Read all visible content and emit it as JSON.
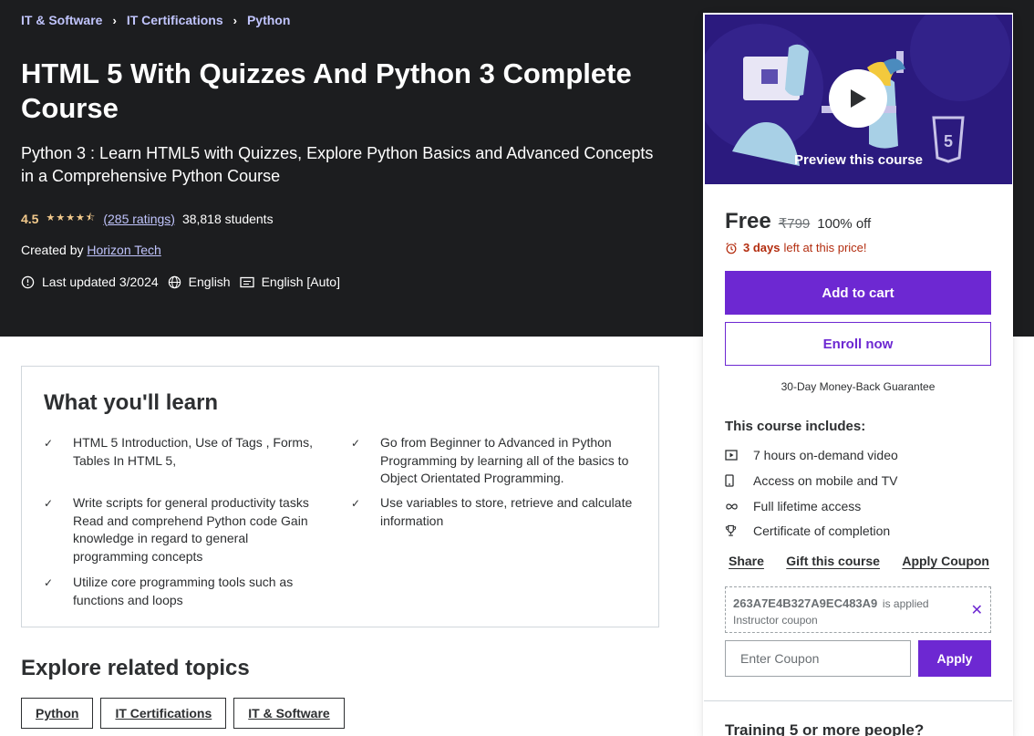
{
  "breadcrumb": [
    "IT & Software",
    "IT Certifications",
    "Python"
  ],
  "course": {
    "title": "HTML 5 With Quizzes And Python 3 Complete Course",
    "subtitle": "Python 3 : Learn HTML5 with Quizzes, Explore Python Basics and Advanced Concepts in a Comprehensive Python Course",
    "rating": "4.5",
    "stars": "★★★★⯪",
    "ratings_count": "(285 ratings)",
    "students": "38,818 students",
    "created_by_label": "Created by",
    "author": "Horizon Tech",
    "last_updated": "Last updated 3/2024",
    "language": "English",
    "captions": "English [Auto]"
  },
  "learn": {
    "title": "What you'll learn",
    "check": "✓",
    "items": [
      "HTML 5 Introduction, Use of Tags , Forms, Tables In HTML 5,",
      "Go from Beginner to Advanced in Python Programming by learning all of the basics to Object Orientated Programming.",
      "Write scripts for general productivity tasks Read and comprehend Python code Gain knowledge in regard to general programming concepts",
      "Use variables to store, retrieve and calculate information",
      "Utilize core programming tools such as functions and loops"
    ]
  },
  "explore": {
    "title": "Explore related topics",
    "topics": [
      "Python",
      "IT Certifications",
      "IT & Software"
    ]
  },
  "sidebar": {
    "preview_label": "Preview this course",
    "price": "Free",
    "original_price": "₹799",
    "discount": "100% off",
    "timer_bold": "3 days",
    "timer_rest": "left at this price!",
    "add_to_cart": "Add to cart",
    "enroll_now": "Enroll now",
    "guarantee": "30-Day Money-Back Guarantee",
    "includes_title": "This course includes:",
    "includes": [
      {
        "icon": "video-icon",
        "text": "7 hours on-demand video"
      },
      {
        "icon": "mobile-icon",
        "text": "Access on mobile and TV"
      },
      {
        "icon": "infinity-icon",
        "text": "Full lifetime access"
      },
      {
        "icon": "trophy-icon",
        "text": "Certificate of completion"
      }
    ],
    "links": [
      "Share",
      "Gift this course",
      "Apply Coupon"
    ],
    "coupon_code": "263A7E4B327A9EC483A9",
    "coupon_applied": "is applied",
    "coupon_type": "Instructor coupon",
    "coupon_placeholder": "Enter Coupon",
    "apply": "Apply",
    "training_title": "Training 5 or more people?"
  },
  "colors": {
    "hero_bg": "#1c1d1f",
    "accent_purple": "#6d28d2",
    "link_lavender": "#c0c4fc",
    "star_gold": "#f3ca8c",
    "alert_red": "#b32d0f"
  }
}
